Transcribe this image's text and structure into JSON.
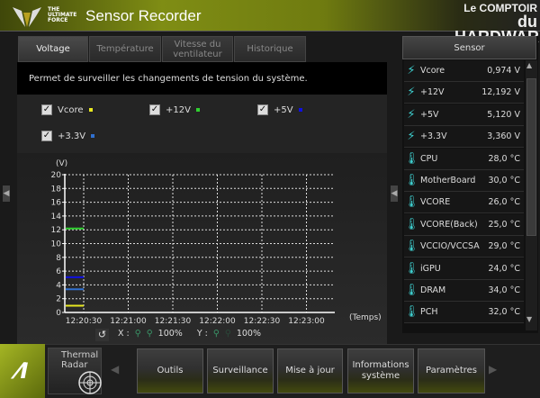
{
  "app": {
    "title": "Sensor Recorder",
    "brand_lines": [
      "THE",
      "ULTIMATE",
      "FORCE"
    ],
    "watermark": [
      "Le COMPTOIR",
      "du HARDWARE"
    ]
  },
  "tabs": [
    {
      "label": "Voltage",
      "active": true
    },
    {
      "label": "Température"
    },
    {
      "label": "Vitesse du ventilateur"
    },
    {
      "label": "Historique"
    }
  ],
  "description": "Permet de surveiller les changements de tension du système.",
  "checks": [
    {
      "label": "Vcore",
      "checked": true,
      "color": "#e8e820"
    },
    {
      "label": "+12V",
      "checked": true,
      "color": "#30d030"
    },
    {
      "label": "+5V",
      "checked": true,
      "color": "#1010e0"
    },
    {
      "label": "+3.3V",
      "checked": true,
      "color": "#3070d0"
    }
  ],
  "chart_data": {
    "type": "line",
    "ylabel": "(V)",
    "xlabel": "(Temps)",
    "ylim": [
      0,
      20
    ],
    "yticks": [
      "0",
      "2",
      "4",
      "6",
      "8",
      "10",
      "12",
      "14",
      "16",
      "18",
      "20"
    ],
    "xticks": [
      "12:20:30",
      "12:21:00",
      "12:21:30",
      "12:22:00",
      "12:22:30",
      "12:23:00"
    ],
    "series": [
      {
        "name": "Vcore",
        "value": 0.974,
        "color": "#e8e820"
      },
      {
        "name": "+12V",
        "value": 12.192,
        "color": "#30d030"
      },
      {
        "name": "+5V",
        "value": 5.12,
        "color": "#1010e0"
      },
      {
        "name": "+3.3V",
        "value": 3.36,
        "color": "#3070d0"
      }
    ]
  },
  "zoom": {
    "x_label": "X :",
    "x_value": "100%",
    "y_label": "Y :",
    "y_value": "100%"
  },
  "sensor": {
    "header": "Sensor",
    "rows": [
      {
        "type": "volt",
        "name": "Vcore",
        "value": "0,974  V"
      },
      {
        "type": "volt",
        "name": "+12V",
        "value": "12,192  V"
      },
      {
        "type": "volt",
        "name": "+5V",
        "value": "5,120  V"
      },
      {
        "type": "volt",
        "name": "+3.3V",
        "value": "3,360  V"
      },
      {
        "type": "temp",
        "name": "CPU",
        "value": "28,0 °C"
      },
      {
        "type": "temp",
        "name": "MotherBoard",
        "value": "30,0 °C"
      },
      {
        "type": "temp",
        "name": "VCORE",
        "value": "26,0 °C"
      },
      {
        "type": "temp",
        "name": "VCORE(Back)",
        "value": "25,0 °C"
      },
      {
        "type": "temp",
        "name": "VCCIO/VCCSA",
        "value": "29,0 °C"
      },
      {
        "type": "temp",
        "name": "iGPU",
        "value": "24,0 °C"
      },
      {
        "type": "temp",
        "name": "DRAM",
        "value": "34,0 °C"
      },
      {
        "type": "temp",
        "name": "PCH",
        "value": "32,0 °C"
      }
    ]
  },
  "bottom": {
    "thermal_radar": "Thermal Radar",
    "buttons": [
      "Outils",
      "Surveillance",
      "Mise à jour",
      "Informations système",
      "Paramètres"
    ]
  }
}
